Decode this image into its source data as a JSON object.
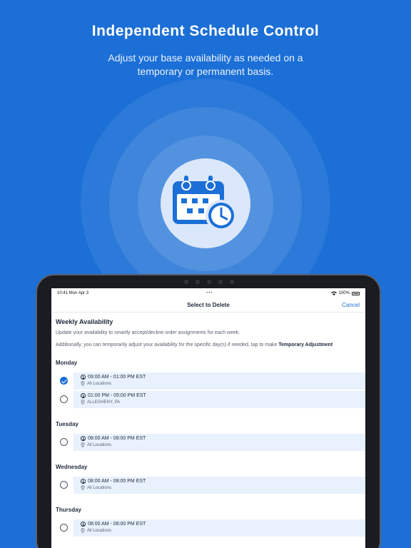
{
  "hero": {
    "headline": "Independent Schedule Control",
    "subline": "Adjust your base availability as needed on a temporary or permanent basis.",
    "icon": "calendar-clock-icon",
    "colors": {
      "background": "#1b6fd6",
      "icon": "#1b6fd6",
      "circle": "#dbe7fb"
    }
  },
  "status_bar": {
    "time": "10:41 Mon Apr 3",
    "battery": "100%"
  },
  "nav": {
    "title": "Select to Delete",
    "cancel_label": "Cancel"
  },
  "availability": {
    "title": "Weekly Availability",
    "description": "Update your availability to smartly accept/decline order assignments for each week.",
    "note_prefix": "Additionally, you can temporarily adjust your availability for the specific day(s) if needed, tap to make",
    "note_bold": "Temporary Adjustment",
    "days": [
      {
        "name": "Monday",
        "slots": [
          {
            "time": "09:00 AM - 01:00 PM EST",
            "location": "All Locations",
            "selected": true
          },
          {
            "time": "01:00 PM - 05:00 PM EST",
            "location": "ALLEGHENY, PA",
            "selected": false
          }
        ]
      },
      {
        "name": "Tuesday",
        "slots": [
          {
            "time": "08:00 AM - 08:00 PM EST",
            "location": "All Locations",
            "selected": false
          }
        ]
      },
      {
        "name": "Wednesday",
        "slots": [
          {
            "time": "08:00 AM - 08:00 PM EST",
            "location": "All Locations",
            "selected": false
          }
        ]
      },
      {
        "name": "Thursday",
        "slots": [
          {
            "time": "08:00 AM - 08:00 PM EST",
            "location": "All Locations",
            "selected": false
          }
        ]
      }
    ]
  }
}
